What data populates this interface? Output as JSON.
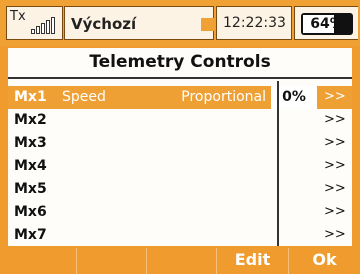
{
  "status": {
    "tx_label": "Tx",
    "model_name": "Výchozí",
    "time": "12:22:33",
    "battery": "64%",
    "battery_level": 0.64,
    "accent_color": "#f0a133"
  },
  "screen": {
    "title": "Telemetry Controls"
  },
  "rows": [
    {
      "name": "Mx1",
      "sensor": "Speed",
      "mode": "Proportional",
      "value": "0%",
      "arrow": ">>"
    },
    {
      "name": "Mx2",
      "sensor": "",
      "mode": "",
      "value": "",
      "arrow": ">>"
    },
    {
      "name": "Mx3",
      "sensor": "",
      "mode": "",
      "value": "",
      "arrow": ">>"
    },
    {
      "name": "Mx4",
      "sensor": "",
      "mode": "",
      "value": "",
      "arrow": ">>"
    },
    {
      "name": "Mx5",
      "sensor": "",
      "mode": "",
      "value": "",
      "arrow": ">>"
    },
    {
      "name": "Mx6",
      "sensor": "",
      "mode": "",
      "value": "",
      "arrow": ">>"
    },
    {
      "name": "Mx7",
      "sensor": "",
      "mode": "",
      "value": "",
      "arrow": ">>"
    }
  ],
  "buttons": {
    "f1": "",
    "f2": "",
    "f3": "",
    "edit": "Edit",
    "ok": "Ok"
  }
}
